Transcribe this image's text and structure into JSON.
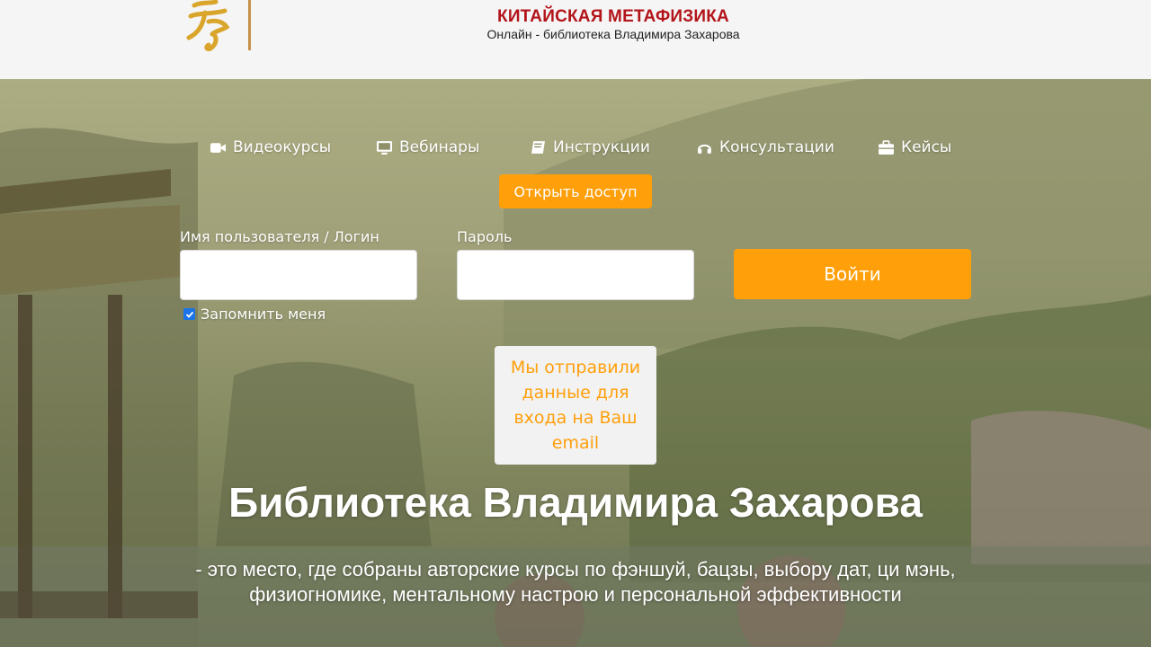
{
  "header": {
    "title": "КИТАЙСКАЯ МЕТАФИЗИКА",
    "subtitle": "Онлайн - библиотека Владимира Захарова",
    "logo_icon": "calligraphy-logo-icon"
  },
  "nav": {
    "items": [
      {
        "label": "Видеокурсы",
        "icon": "video-camera-icon"
      },
      {
        "label": "Вебинары",
        "icon": "monitor-icon"
      },
      {
        "label": "Инструкции",
        "icon": "book-icon"
      },
      {
        "label": "Консультации",
        "icon": "headphones-icon"
      },
      {
        "label": "Кейсы",
        "icon": "briefcase-icon"
      }
    ]
  },
  "login": {
    "open_access_label": "Открыть доступ",
    "username_label": "Имя пользователя / Логин",
    "username_value": "",
    "password_label": "Пароль",
    "password_value": "",
    "submit_label": "Войти",
    "remember_label": "Запомнить меня",
    "remember_checked": true
  },
  "notice": {
    "text": "Мы отправили данные для входа на Ваш email"
  },
  "hero": {
    "title": "Библиотека Владимира Захарова",
    "text_line1": "- это место, где собраны авторские курсы по фэншуй, бацзы, выбору дат, ци мэнь,",
    "text_line2": "физиогномике, ментальному настрою и персональной эффективности"
  },
  "colors": {
    "accent": "#ff9f0a",
    "title_red": "#b3141a",
    "header_bg": "#f5f5f5",
    "logo_gold": "#d9a52b"
  }
}
